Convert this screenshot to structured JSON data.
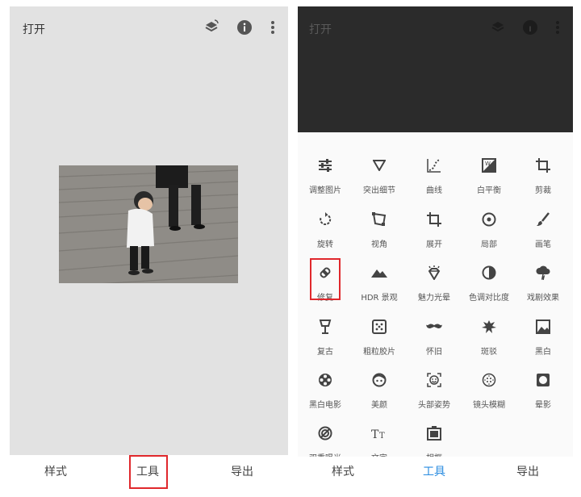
{
  "left": {
    "topbar": {
      "open_label": "打开"
    },
    "bottom": {
      "styles": "样式",
      "tools": "工具",
      "export": "导出"
    }
  },
  "right": {
    "topbar": {
      "open_label": "打开"
    },
    "tools": [
      {
        "label": "调整图片",
        "icon": "sliders-icon"
      },
      {
        "label": "突出细节",
        "icon": "triangle-icon"
      },
      {
        "label": "曲线",
        "icon": "curves-icon"
      },
      {
        "label": "白平衡",
        "icon": "white-balance-icon"
      },
      {
        "label": "剪裁",
        "icon": "crop-icon"
      },
      {
        "label": "旋转",
        "icon": "rotate-icon"
      },
      {
        "label": "视角",
        "icon": "perspective-icon"
      },
      {
        "label": "展开",
        "icon": "expand-icon"
      },
      {
        "label": "局部",
        "icon": "selective-icon"
      },
      {
        "label": "画笔",
        "icon": "brush-icon"
      },
      {
        "label": "修复",
        "icon": "healing-icon"
      },
      {
        "label": "HDR 景观",
        "icon": "mountain-icon"
      },
      {
        "label": "魅力光晕",
        "icon": "glamour-glow-icon"
      },
      {
        "label": "色调对比度",
        "icon": "tonal-contrast-icon"
      },
      {
        "label": "戏剧效果",
        "icon": "drama-cloud-icon"
      },
      {
        "label": "复古",
        "icon": "vintage-lamp-icon"
      },
      {
        "label": "粗粒胶片",
        "icon": "grainy-film-icon"
      },
      {
        "label": "怀旧",
        "icon": "mustache-icon"
      },
      {
        "label": "斑驳",
        "icon": "grunge-icon"
      },
      {
        "label": "黑白",
        "icon": "black-white-icon"
      },
      {
        "label": "黑白电影",
        "icon": "film-reel-icon"
      },
      {
        "label": "美颜",
        "icon": "face-icon"
      },
      {
        "label": "头部姿势",
        "icon": "head-pose-icon"
      },
      {
        "label": "镜头模糊",
        "icon": "lens-blur-icon"
      },
      {
        "label": "晕影",
        "icon": "vignette-icon"
      },
      {
        "label": "双重曝光",
        "icon": "double-exposure-icon"
      },
      {
        "label": "文字",
        "icon": "text-icon"
      },
      {
        "label": "相框",
        "icon": "frame-icon"
      }
    ],
    "bottom": {
      "styles": "样式",
      "tools": "工具",
      "export": "导出"
    }
  },
  "colors": {
    "highlight": "#e0282c",
    "active_tab": "#2a8ce0",
    "dark_area": "#2b2b2b"
  }
}
